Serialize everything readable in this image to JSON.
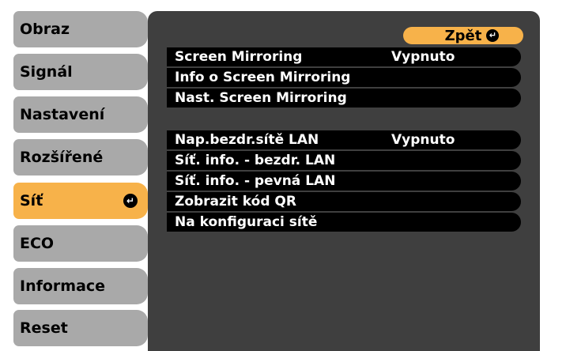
{
  "sidebar": {
    "items": [
      {
        "label": "Obraz",
        "active": false
      },
      {
        "label": "Signál",
        "active": false
      },
      {
        "label": "Nastavení",
        "active": false
      },
      {
        "label": "Rozšířené",
        "active": false
      },
      {
        "label": "Síť",
        "active": true
      },
      {
        "label": "ECO",
        "active": false
      },
      {
        "label": "Informace",
        "active": false
      },
      {
        "label": "Reset",
        "active": false
      }
    ]
  },
  "panel": {
    "back_label": "Zpět",
    "rows": [
      {
        "label": "Screen Mirroring",
        "value": "Vypnuto"
      },
      {
        "label": "Info o Screen Mirroring",
        "value": ""
      },
      {
        "label": "Nast. Screen Mirroring",
        "value": ""
      },
      {
        "label": "Nap.bezdr.sítě LAN",
        "value": "Vypnuto"
      },
      {
        "label": "Síť. info. - bezdr. LAN",
        "value": ""
      },
      {
        "label": "Síť. info. - pevná LAN",
        "value": ""
      },
      {
        "label": "Zobrazit kód QR",
        "value": ""
      },
      {
        "label": "Na konfiguraci sítě",
        "value": ""
      }
    ]
  },
  "colors": {
    "menu_item": "#a9a9a9",
    "menu_active": "#f7b24a",
    "panel_bg": "#3f3f3f",
    "row_bg": "#000000",
    "accent": "#f7b24a"
  },
  "icons": {
    "enter": "enter-icon"
  }
}
